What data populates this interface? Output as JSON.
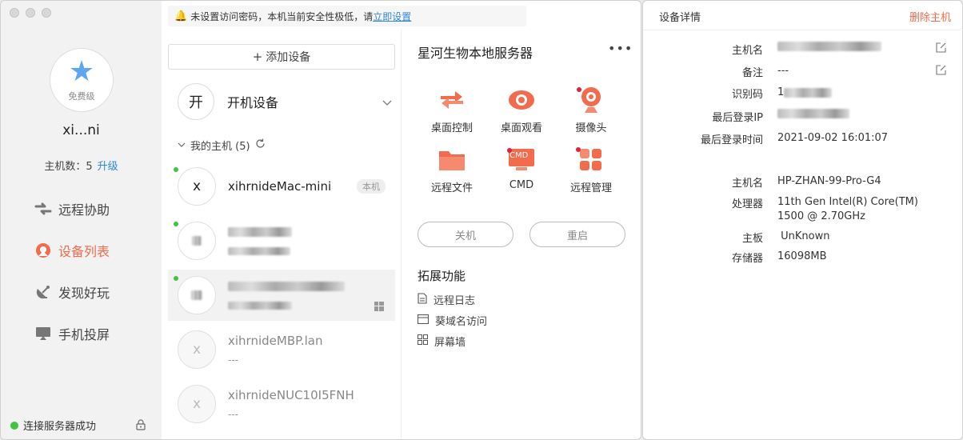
{
  "notice": {
    "text": "未设置访问密码，本机当前安全性极低，请",
    "link": "立即设置"
  },
  "sidebar": {
    "avatar_level": "免费级",
    "username": "xi...ni",
    "host_count_label": "主机数：5",
    "upgrade": "升级",
    "nav": [
      {
        "label": "远程协助",
        "icon": "remote-assist-icon"
      },
      {
        "label": "设备列表",
        "icon": "device-list-icon",
        "active": true
      },
      {
        "label": "发现好玩",
        "icon": "discover-icon"
      },
      {
        "label": "手机投屏",
        "icon": "screen-cast-icon"
      }
    ],
    "status": "连接服务器成功"
  },
  "device_list": {
    "add_label": "添加设备",
    "power_device": {
      "icon_char": "开",
      "label": "开机设备"
    },
    "group_label": "我的主机 (5)",
    "devices": [
      {
        "initial": "x",
        "name": "xihrnideMac-mini",
        "badge": "本机",
        "online": true
      },
      {
        "initial": "",
        "name": "",
        "sub": "",
        "online": true
      },
      {
        "initial": "",
        "name": "",
        "sub": "",
        "online": true,
        "selected": true
      },
      {
        "initial": "x",
        "name": "xihrnideMBP.lan",
        "sub": "---",
        "online": false
      },
      {
        "initial": "x",
        "name": "xihrnideNUC10I5FNH",
        "sub": "---",
        "online": false
      }
    ]
  },
  "detail": {
    "title": "星河生物本地服务器",
    "more": "•••",
    "functions": [
      {
        "label": "桌面控制",
        "icon": "desktop-control-icon"
      },
      {
        "label": "桌面观看",
        "icon": "desktop-view-icon"
      },
      {
        "label": "摄像头",
        "icon": "camera-icon"
      },
      {
        "label": "远程文件",
        "icon": "folder-icon"
      },
      {
        "label": "CMD",
        "icon": "cmd-icon",
        "icon_text": "CMD"
      },
      {
        "label": "远程管理",
        "icon": "remote-manage-icon"
      }
    ],
    "shutdown": "关机",
    "restart": "重启",
    "ext_title": "拓展功能",
    "ext": [
      {
        "label": "远程日志",
        "icon": "log-icon"
      },
      {
        "label": "葵域名访问",
        "icon": "domain-icon"
      },
      {
        "label": "屏幕墙",
        "icon": "screen-wall-icon"
      }
    ]
  },
  "panel": {
    "title": "设备详情",
    "delete": "删除主机",
    "rows": [
      {
        "k": "主机名",
        "v": ""
      },
      {
        "k": "备注",
        "v": "---"
      },
      {
        "k": "识别码",
        "v": "1"
      },
      {
        "k": "最后登录IP",
        "v": ""
      },
      {
        "k": "最后登录时间",
        "v": "2021-09-02 16:01:07"
      },
      {
        "k": "主机名",
        "v": "HP-ZHAN-99-Pro-G4"
      },
      {
        "k": "处理器",
        "v": "11th Gen Intel(R) Core(TM)",
        "v2": "1500 @ 2.70GHz"
      },
      {
        "k": "主板",
        "v": " UnKnown"
      },
      {
        "k": "存储器",
        "v": "16098MB"
      }
    ]
  },
  "colors": {
    "accent": "#f26b4c",
    "link": "#2f86d8",
    "online": "#3ec43e"
  }
}
